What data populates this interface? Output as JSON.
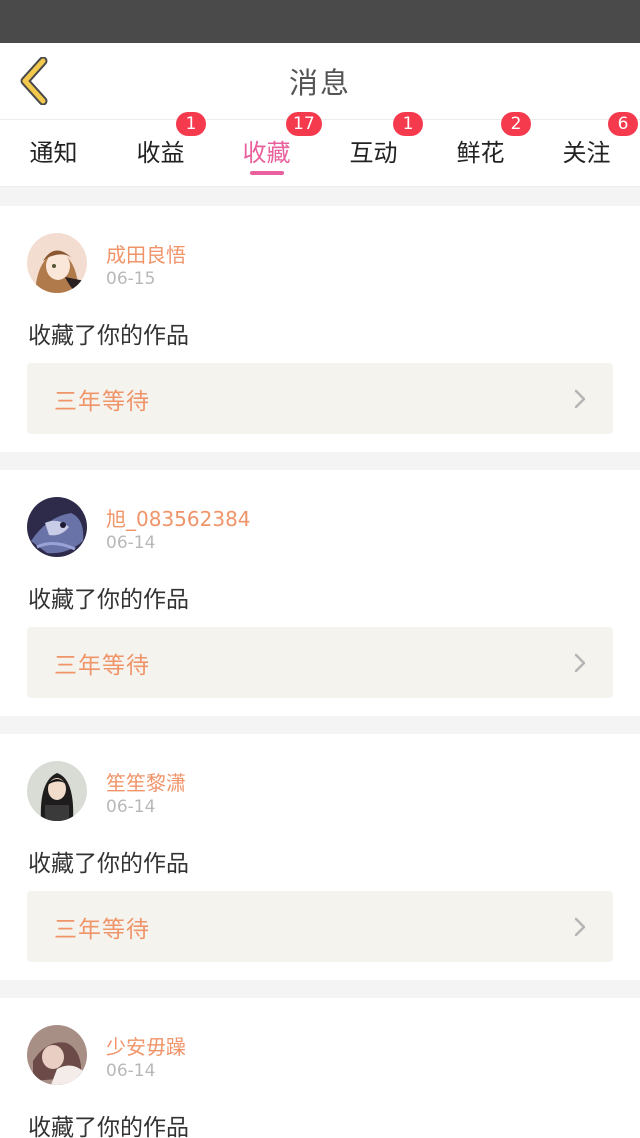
{
  "header": {
    "title": "消息"
  },
  "tabs": [
    {
      "label": "通知",
      "badge": null
    },
    {
      "label": "收益",
      "badge": "1"
    },
    {
      "label": "收藏",
      "badge": "17",
      "active": true
    },
    {
      "label": "互动",
      "badge": "1"
    },
    {
      "label": "鲜花",
      "badge": "2"
    },
    {
      "label": "关注",
      "badge": "6"
    }
  ],
  "colors": {
    "accent": "#e8609c",
    "name": "#f0946a",
    "badge": "#f53a4e",
    "back_icon": "#f2c94c"
  },
  "items": [
    {
      "user": "成田良悟",
      "date": "06-15",
      "message": "收藏了你的作品",
      "work": "三年等待"
    },
    {
      "user": "旭_083562384",
      "date": "06-14",
      "message": "收藏了你的作品",
      "work": "三年等待"
    },
    {
      "user": "笙笙黎潇",
      "date": "06-14",
      "message": "收藏了你的作品",
      "work": "三年等待"
    },
    {
      "user": "少安毋躁",
      "date": "06-14",
      "message": "收藏了你的作品",
      "work": null
    }
  ]
}
